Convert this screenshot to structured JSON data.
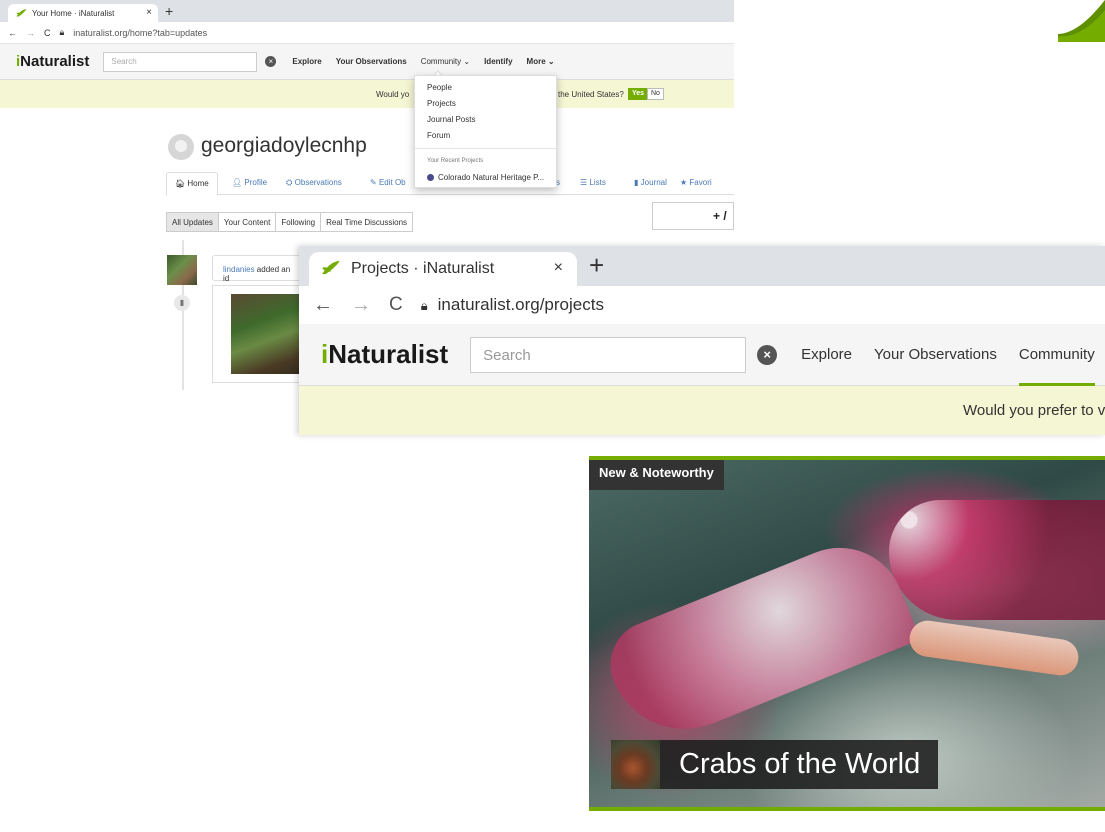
{
  "window1": {
    "tab_title": "Your Home · iNaturalist",
    "tab_close": "×",
    "new_tab": "+",
    "url": "inaturalist.org/home?tab=updates",
    "logo_i": "i",
    "logo_rest": "Naturalist",
    "search_placeholder": "Search",
    "menu": [
      "Explore",
      "Your Observations",
      "Community ⌄",
      "Identify",
      "More ⌄"
    ],
    "banner_left": "Would yo",
    "banner_right": "the United States?",
    "yes": "Yes",
    "no": "No",
    "username": "georgiadoylecnhp",
    "profile_tabs": [
      "Home",
      "Profile",
      "Observations",
      "Edit Ob",
      "s",
      "Lists",
      "Journal",
      "Favori"
    ],
    "add_button": "+ /",
    "filters": [
      "All Updates",
      "Your Content",
      "Following",
      "Real Time Discussions"
    ],
    "feed_user": "lindanies",
    "feed_text": " added an id",
    "dropdown": {
      "items": [
        "People",
        "Projects",
        "Journal Posts",
        "Forum"
      ],
      "recent_header": "Your Recent Projects",
      "recent_project": "Colorado Natural Heritage P..."
    }
  },
  "window2": {
    "tab_title": "Projects · iNaturalist",
    "tab_close": "×",
    "new_tab": "+",
    "url": "inaturalist.org/projects",
    "logo_i": "i",
    "logo_rest": "Naturalist",
    "search_placeholder": "Search",
    "menu": [
      "Explore",
      "Your Observations",
      "Community"
    ],
    "banner": "Would you prefer to vi"
  },
  "feature": {
    "label": "New & Noteworthy",
    "title": "Crabs of the World"
  },
  "colors": {
    "brand_green": "#74ac00",
    "banner_bg": "#f5f6d4"
  }
}
